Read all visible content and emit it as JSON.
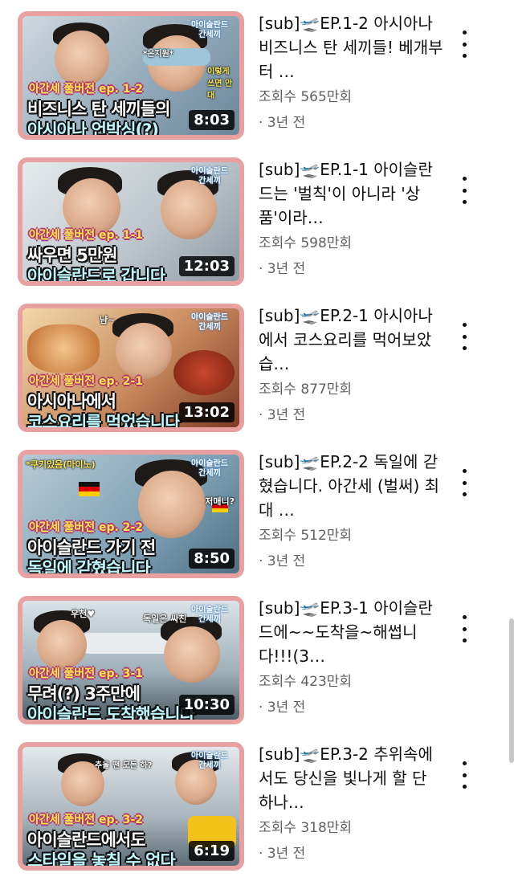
{
  "videos": [
    {
      "title": "[sub]🛫EP.1-2 아시아나 비즈니스 탄 세끼들! 베개부터 …",
      "views": "조회수 565만회",
      "age": "· 3년 전",
      "duration": "8:03",
      "thumb": {
        "logo": "아이슬란드 간세끼",
        "episode": "아간세 풀버전 ep. 1-2",
        "caption1": "비즈니스 탄 세끼들의",
        "caption2": "아시아나 언박싱(?)",
        "note1": "*은지원*",
        "note2": "이렇게 쓰면 안대",
        "bg": "#8fa7b8"
      }
    },
    {
      "title": "[sub]🛫EP.1-1 아이슬란드는 '벌칙'이 아니라 '상품'이라…",
      "views": "조회수 598만회",
      "age": "· 3년 전",
      "duration": "12:03",
      "thumb": {
        "logo": "아이슬란드 간세끼",
        "episode": "아간세 풀버전 ep. 1-1",
        "caption1": "싸우면 5만원",
        "caption2": "아이슬란드로 갑니다",
        "note1": "",
        "note2": "",
        "bg": "#b9c3c9"
      }
    },
    {
      "title": "[sub]🛫EP.2-1 아시아나에서 코스요리를 먹어보았습…",
      "views": "조회수 877만회",
      "age": "· 3년 전",
      "duration": "13:02",
      "thumb": {
        "logo": "아이슬란드 간세끼",
        "episode": "아간세 풀버전 ep. 2-1",
        "caption1": "아시아나에서",
        "caption2": "코스요리를 먹었습니다",
        "note1": "냠~",
        "note2": "",
        "bg": "#c98a5e"
      }
    },
    {
      "title": "[sub]🛫EP.2-2 독일에 갇혔습니다. 아간세 (벌써) 최대 …",
      "views": "조회수 512만회",
      "age": "· 3년 전",
      "duration": "8:50",
      "thumb": {
        "logo": "아이슬란드 간세끼",
        "episode": "아간세 풀버전 ep. 2-2",
        "caption1": "아이슬란드 가기 전",
        "caption2": "독일에 갇혔습니다",
        "note1": "*쿠키있음(마이노)",
        "note2": "저매니?",
        "bg": "#7ea0b4"
      }
    },
    {
      "title": "[sub]🛫EP.3-1 아이슬란드에~~도착을~해썹니다!!!(3…",
      "views": "조회수 423만회",
      "age": "· 3년 전",
      "duration": "10:30",
      "thumb": {
        "logo": "아이슬란드 간세끼",
        "episode": "아간세 풀버전 ep. 3-1",
        "caption1": "무려(?) 3주만에",
        "caption2": "아이슬란드 도착했습니다",
        "note1": "우천♥",
        "note2": "독일은 싸친",
        "bg": "#9fb0ba"
      }
    },
    {
      "title": "[sub]🛫EP.3-2 추위속에서도 당신을 빛나게 할 단 하나…",
      "views": "조회수 318만회",
      "age": "· 3년 전",
      "duration": "6:19",
      "thumb": {
        "logo": "아이슬란드 간세끼",
        "episode": "아간세 풀버전 ep. 3-2",
        "caption1": "아이슬란드에서도",
        "caption2": "스타일을 놓칠 수 없다",
        "note1": "추울 땐 모든 하?",
        "note2": "",
        "bg": "#a8b4bc"
      }
    }
  ],
  "colors": {
    "thumb_border": "#e8a0a0",
    "title": "#0f0f0f",
    "meta": "#606060"
  },
  "icons": {
    "menu": "more-vert-icon"
  }
}
